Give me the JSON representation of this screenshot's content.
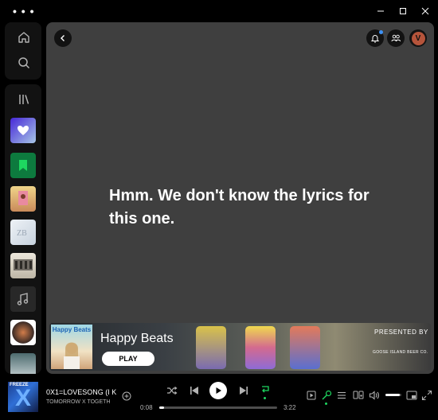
{
  "window": {
    "menu_icon": "more-dots-icon",
    "controls": [
      "minimize-icon",
      "maximize-icon",
      "close-icon"
    ]
  },
  "nav": {
    "home_icon": "home-icon",
    "search_icon": "search-icon",
    "library_icon": "library-icon"
  },
  "library": {
    "items": [
      {
        "name": "liked-songs",
        "icon": "heart-icon",
        "color": "#5b3ddb"
      },
      {
        "name": "your-episodes",
        "icon": "bookmark-icon",
        "color": "#0d7a3e"
      },
      {
        "name": "playlist-1",
        "icon": "",
        "color": "#e6c87a"
      },
      {
        "name": "playlist-2",
        "icon": "",
        "color": "#dde3ea"
      },
      {
        "name": "playlist-3",
        "icon": "",
        "color": "#d9d5c8"
      },
      {
        "name": "playlist-4",
        "icon": "music-note-icon",
        "color": "#282828"
      },
      {
        "name": "playlist-5",
        "icon": "",
        "color": "#3a2a25"
      },
      {
        "name": "playlist-6",
        "icon": "",
        "color": "#8aa1a8"
      }
    ]
  },
  "header": {
    "avatar_initial": "V",
    "notification_icon": "bell-icon",
    "friends_icon": "friends-icon",
    "back_icon": "chevron-left-icon"
  },
  "lyrics": {
    "message": "Hmm. We don't know the lyrics for this one."
  },
  "ad": {
    "art_title": "Happy Beats",
    "title": "Happy Beats",
    "play_label": "PLAY",
    "presented_by": "PRESENTED BY",
    "brand": "GOOSE ISLAND BEER CO."
  },
  "player": {
    "cover_label": "FREEZE",
    "cover_letter": "X",
    "track_title": "0X1=LOVESONG (I K",
    "artist": "TOMORROW X TOGETH",
    "elapsed": "0:08",
    "duration": "3:22",
    "progress": 0.04,
    "volume": 0.9,
    "accent": "#1ed760"
  }
}
